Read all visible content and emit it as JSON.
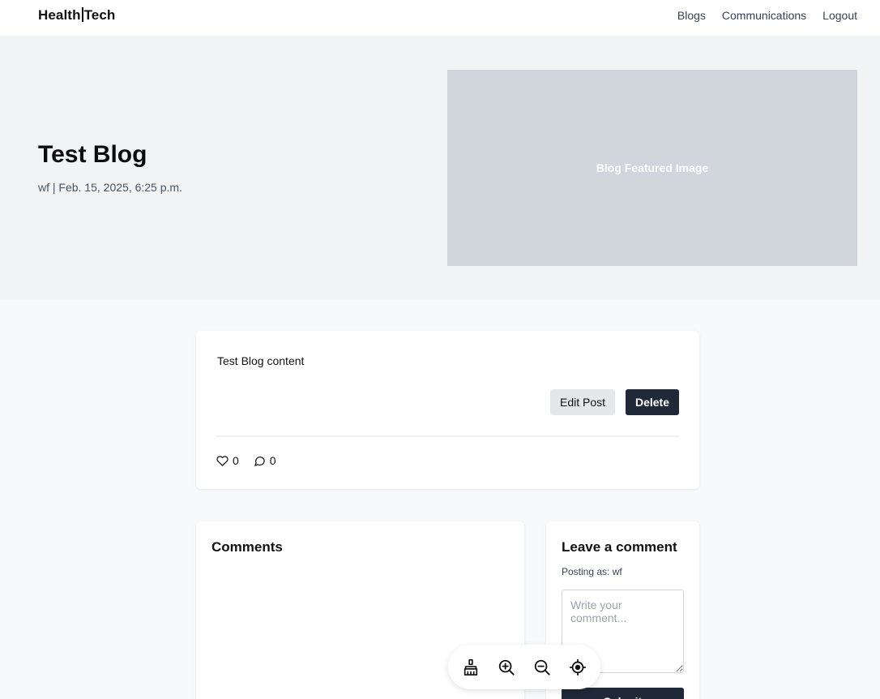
{
  "brand": {
    "left": "Health",
    "right": "Tech"
  },
  "nav": {
    "links": [
      "Blogs",
      "Communications",
      "Logout"
    ]
  },
  "hero": {
    "title": "Test Blog",
    "meta": "wf | Feb. 15, 2025, 6:25 p.m.",
    "image_text": "Blog Featured Image"
  },
  "post": {
    "content": "Test Blog content",
    "edit_label": "Edit Post",
    "delete_label": "Delete",
    "likes": "0",
    "comments": "0"
  },
  "comments": {
    "title": "Comments"
  },
  "leave_comment": {
    "title": "Leave a comment",
    "posting_as": "Posting as: wf",
    "placeholder": "Write your comment...",
    "submit_label": "Submit"
  },
  "toolbar": {
    "icons": [
      "broom-icon",
      "zoom-in-icon",
      "zoom-out-icon",
      "locate-icon"
    ]
  },
  "colors": {
    "hero_bg": "#f2f3f5",
    "image_placeholder": "#d1d5dc",
    "primary_button": "#1f2937",
    "secondary_button": "#e5e7eb"
  }
}
